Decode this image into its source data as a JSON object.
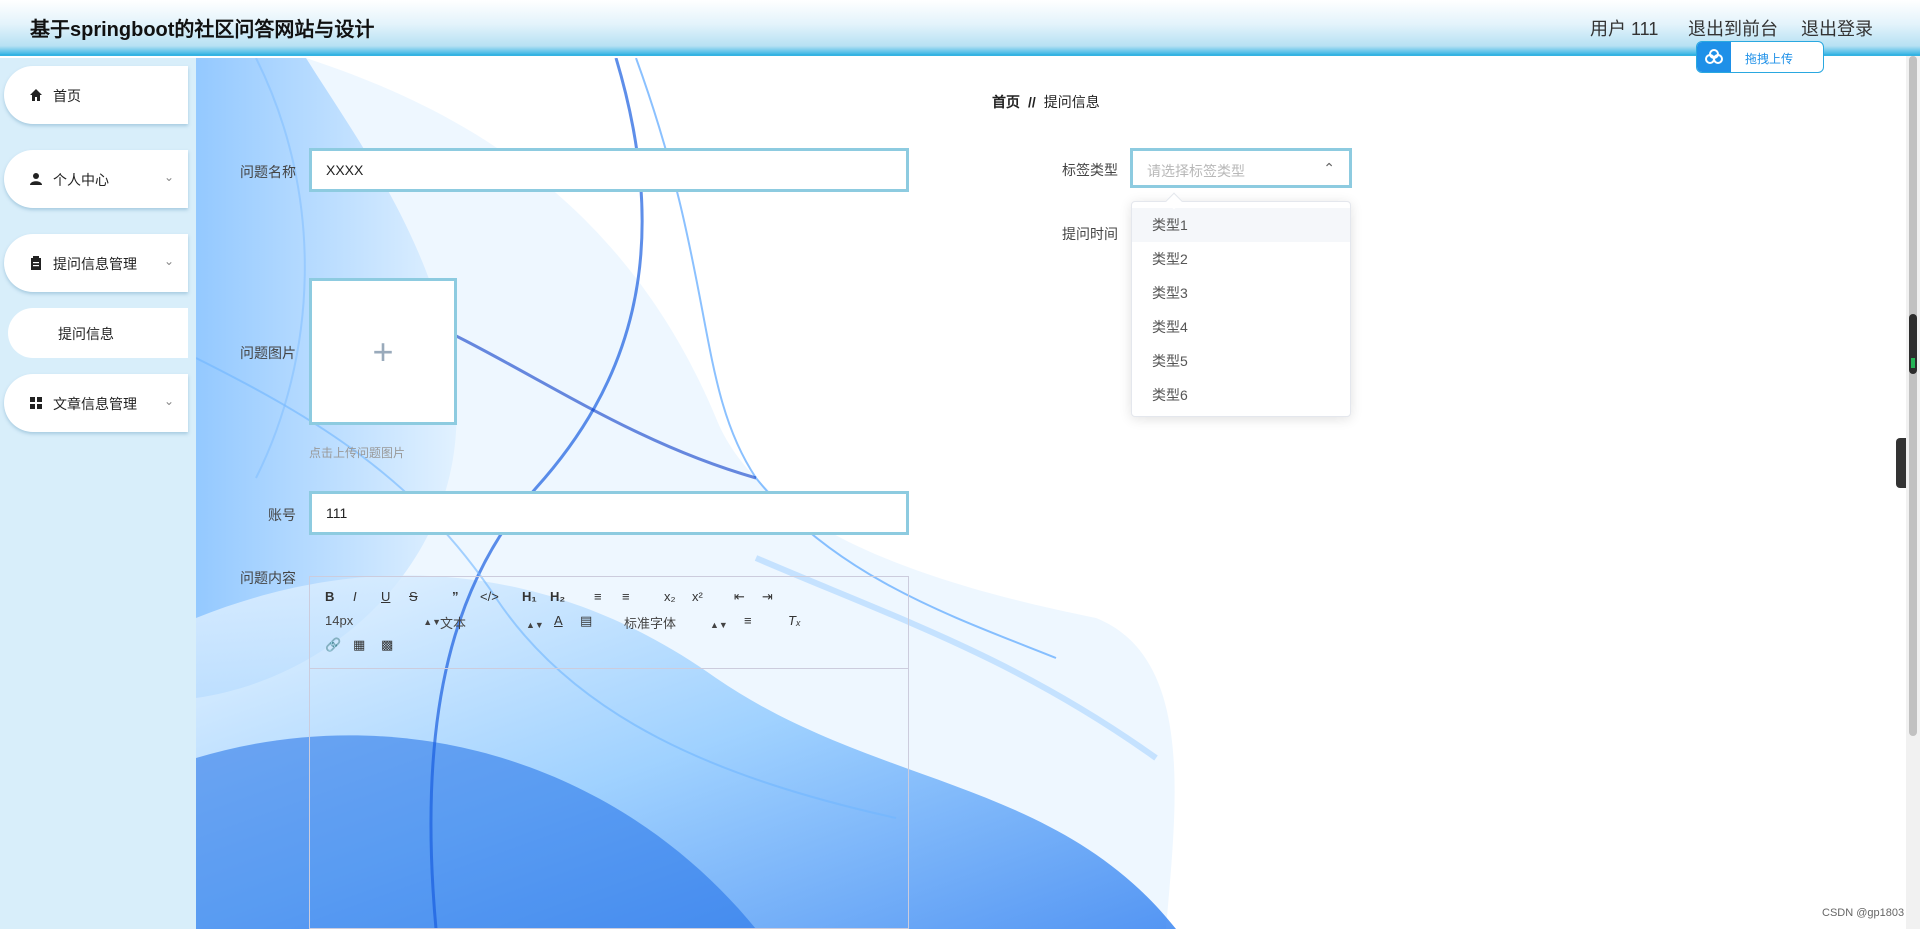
{
  "header": {
    "title": "基于springboot的社区问答网站与设计",
    "user_label": "用户 111",
    "nav_front": "退出到前台",
    "nav_logout": "退出登录",
    "upload_button": "拖拽上传"
  },
  "sidebar": {
    "items": [
      {
        "label": "首页",
        "icon": "home-icon"
      },
      {
        "label": "个人中心",
        "icon": "user-icon"
      },
      {
        "label": "提问信息管理",
        "icon": "clipboard-icon"
      },
      {
        "label": "文章信息管理",
        "icon": "grid-icon"
      }
    ],
    "submenu": {
      "label": "提问信息"
    }
  },
  "breadcrumb": {
    "home": "首页",
    "separator": "//",
    "current": "提问信息"
  },
  "form": {
    "question_name_label": "问题名称",
    "question_name_value": "XXXX",
    "question_image_label": "问题图片",
    "upload_hint": "点击上传问题图片",
    "account_label": "账号",
    "account_value": "111",
    "content_label": "问题内容",
    "tag_label": "标签类型",
    "tag_placeholder": "请选择标签类型",
    "time_label": "提问时间"
  },
  "dropdown": {
    "options": [
      "类型1",
      "类型2",
      "类型3",
      "类型4",
      "类型5",
      "类型6"
    ],
    "hovered": "类型1"
  },
  "editor": {
    "font_size": "14px",
    "paragraph": "文本",
    "font_family": "标准字体"
  },
  "watermark": "CSDN @gp1803",
  "colors": {
    "accent": "#35b3e2",
    "input_border": "#8dcbe0",
    "sidebar": "#d8eefa"
  }
}
